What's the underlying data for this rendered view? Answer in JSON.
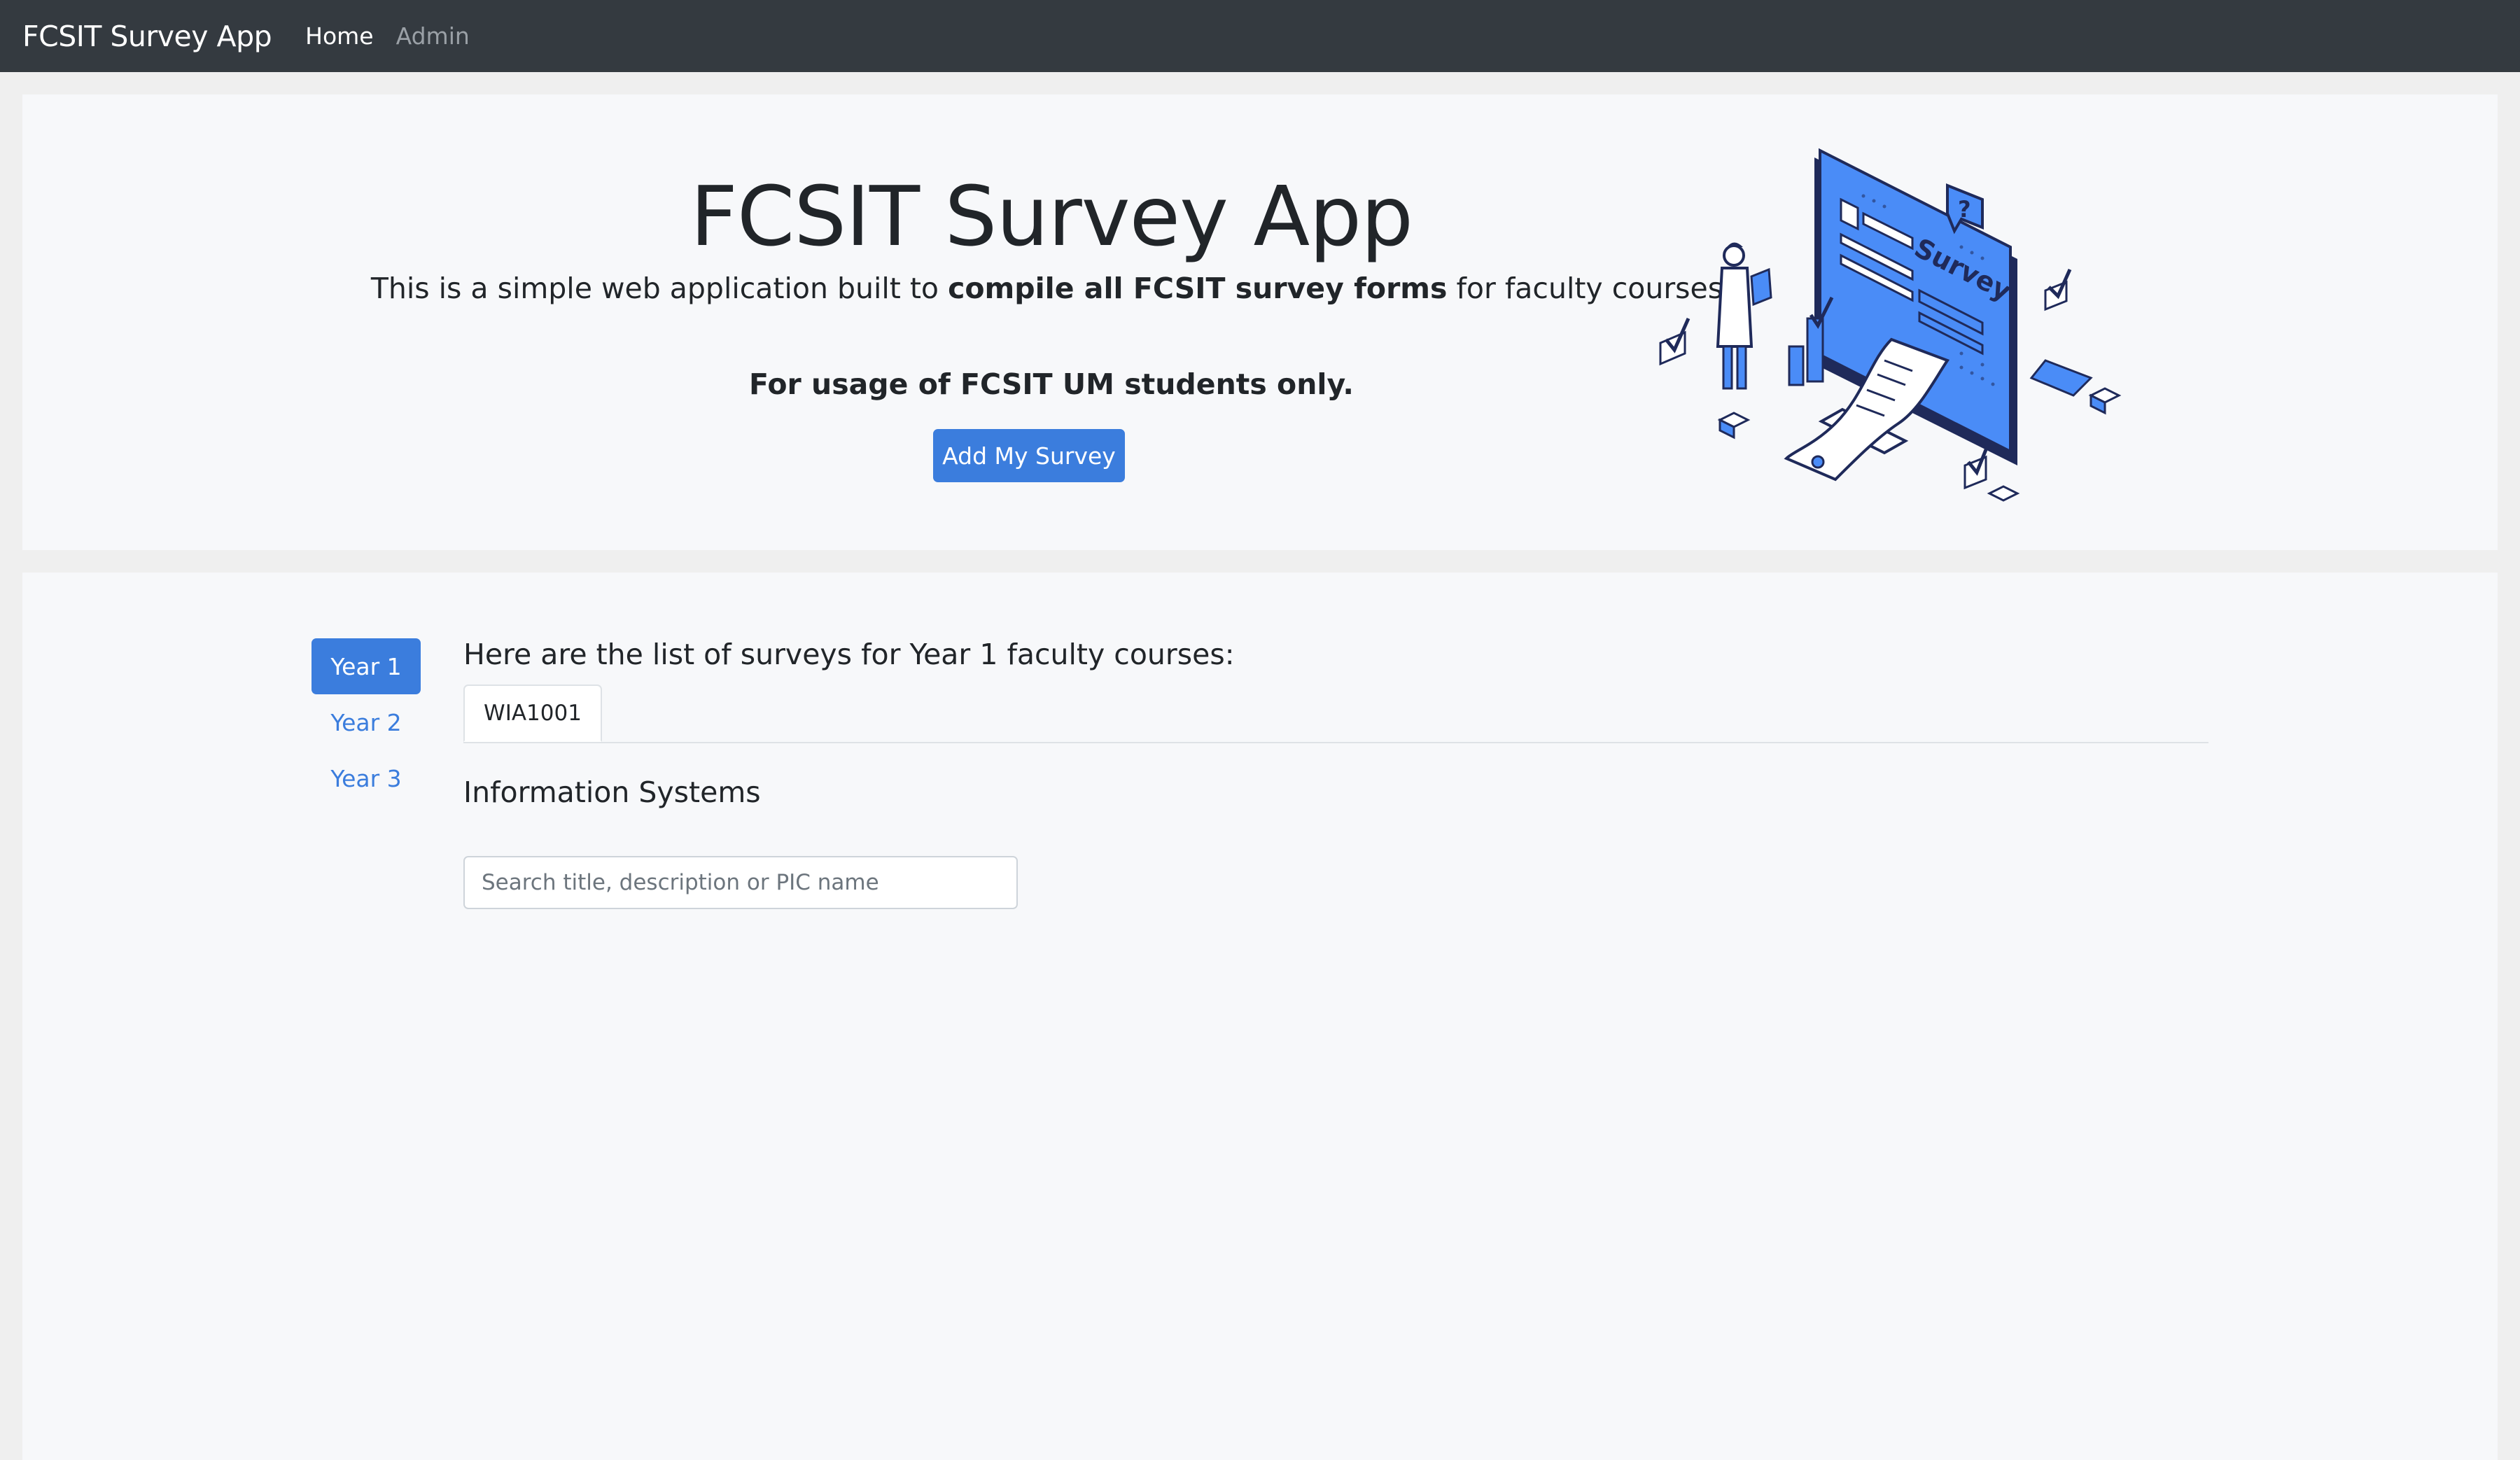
{
  "navbar": {
    "brand": "FCSIT Survey App",
    "links": [
      {
        "label": "Home",
        "active": true
      },
      {
        "label": "Admin",
        "active": false
      }
    ]
  },
  "hero": {
    "title": "FCSIT Survey App",
    "lead_before": "This is a simple web application built to ",
    "lead_bold": "compile all FCSIT survey forms",
    "lead_after": " for faculty courses.",
    "note": "For usage of FCSIT UM students only.",
    "button_label": "Add My Survey",
    "illustration": {
      "screen_text": "Survey",
      "question_mark": "?"
    }
  },
  "sidebar": {
    "years": [
      {
        "label": "Year 1",
        "active": true
      },
      {
        "label": "Year 2",
        "active": false
      },
      {
        "label": "Year 3",
        "active": false
      }
    ]
  },
  "main": {
    "heading": "Here are the list of surveys for Year 1 faculty courses:",
    "tabs": [
      {
        "label": "WIA1001",
        "active": true
      }
    ],
    "course_name": "Information Systems",
    "search": {
      "placeholder": "Search title, description or PIC name",
      "value": ""
    }
  },
  "colors": {
    "navbar_bg": "#343a40",
    "primary": "#3b7ddd",
    "panel_bg": "#f7f8fa",
    "page_bg": "#efefef",
    "illustration_blue": "#4a8cf7",
    "illustration_ink": "#1f2a5a"
  }
}
